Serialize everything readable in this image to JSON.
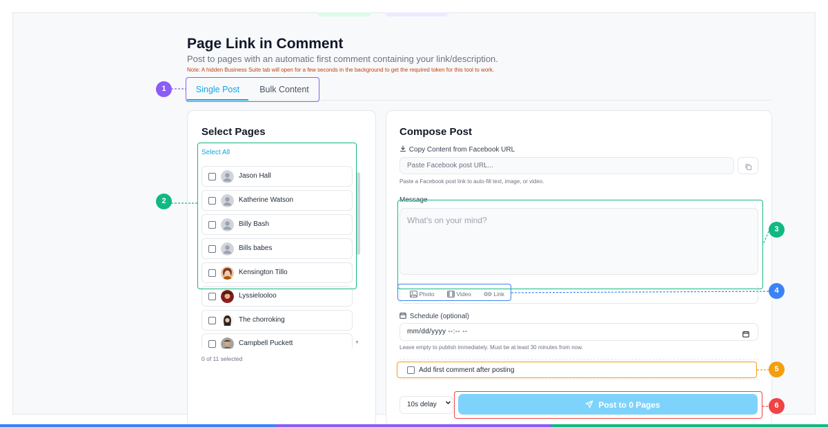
{
  "header": {
    "title": "Page Link in Comment",
    "subtitle": "Post to pages with an automatic first comment containing your link/description.",
    "note": "Note: A hidden Business Suite tab will open for a few seconds in the background to get the required token for this tool to work."
  },
  "tabs": [
    {
      "label": "Single Post",
      "active": true
    },
    {
      "label": "Bulk Content",
      "active": false
    }
  ],
  "select_pages": {
    "title": "Select Pages",
    "select_all": "Select All",
    "pages": [
      {
        "name": "Jason Hall",
        "avatar": "default-avatar"
      },
      {
        "name": "Katherine Watson",
        "avatar": "default-avatar"
      },
      {
        "name": "Billy Bash",
        "avatar": "default-avatar"
      },
      {
        "name": "Bills babes",
        "avatar": "default-avatar"
      },
      {
        "name": "Kensington Tillo",
        "avatar": "photo-avatar"
      },
      {
        "name": "Lyssielooloo",
        "avatar": "photo-avatar"
      },
      {
        "name": "The chorroking",
        "avatar": "photo-avatar"
      },
      {
        "name": "Campbell Puckett",
        "avatar": "photo-avatar"
      }
    ],
    "selected_count": "0 of 11 selected"
  },
  "compose": {
    "title": "Compose Post",
    "copy_label": "Copy Content from Facebook URL",
    "url_placeholder": "Paste Facebook post URL...",
    "url_hint": "Paste a Facebook post link to auto-fill text, image, or video.",
    "message_label": "Message",
    "message_placeholder": "What's on your mind?",
    "attachments": [
      {
        "label": "Photo",
        "icon": "image-icon"
      },
      {
        "label": "Video",
        "icon": "film-icon"
      },
      {
        "label": "Link",
        "icon": "link-icon"
      }
    ],
    "schedule_label": "Schedule (optional)",
    "schedule_placeholder": "mm/dd/yyyy --:-- --",
    "schedule_hint": "Leave empty to publish immediately. Must be at least 30 minutes from now.",
    "first_comment_label": "Add first comment after posting",
    "delay_value": "10s delay",
    "post_button": "Post to 0 Pages"
  },
  "annotations": [
    {
      "number": "1",
      "color": "#8b5cf6"
    },
    {
      "number": "2",
      "color": "#10b981"
    },
    {
      "number": "3",
      "color": "#10b981"
    },
    {
      "number": "4",
      "color": "#3b82f6"
    },
    {
      "number": "5",
      "color": "#f59e0b"
    },
    {
      "number": "6",
      "color": "#ef4444"
    }
  ],
  "colors": {
    "accent": "#0ea5e9",
    "post_button": "#7dd3fc",
    "note_text": "#c2410c"
  }
}
